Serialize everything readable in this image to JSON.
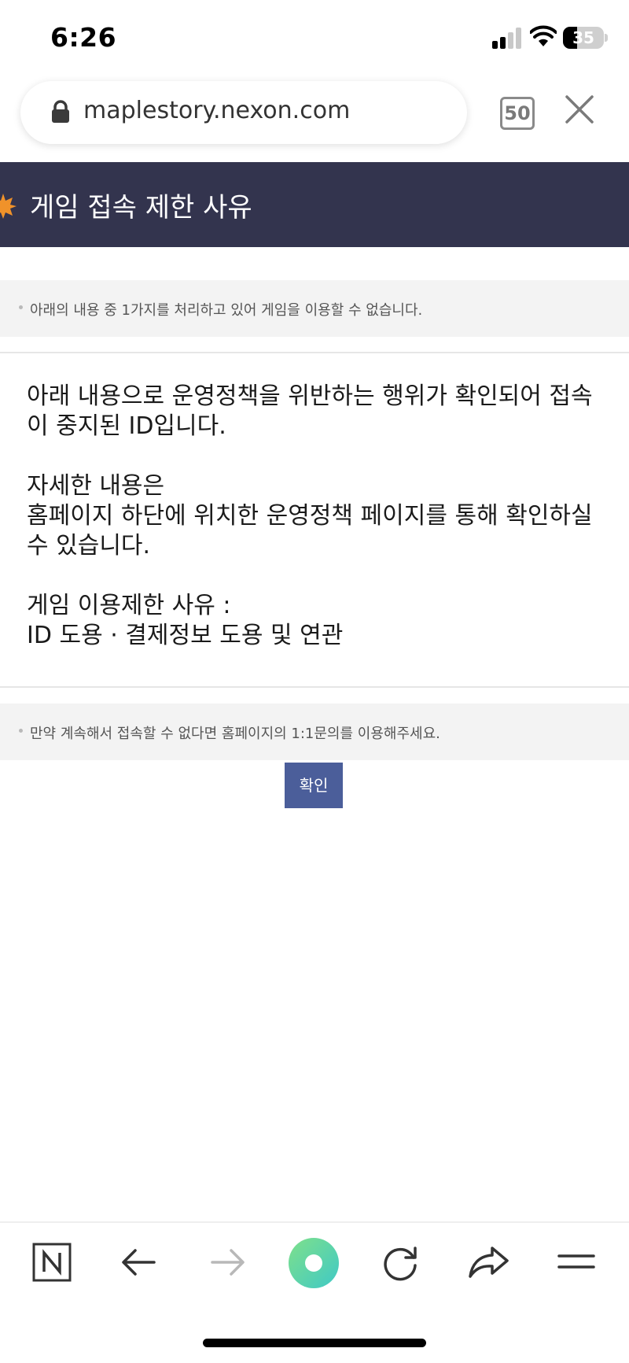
{
  "status_bar": {
    "time": "6:26",
    "battery": "35"
  },
  "browser": {
    "url": "maplestory.nexon.com",
    "tab_count": "50"
  },
  "page": {
    "title": "게임 접속 제한 사유",
    "notice_top": "아래의 내용 중 1가지를 처리하고 있어 게임을 이용할 수 없습니다.",
    "body_text": "아래 내용으로 운영정책을 위반하는 행위가 확인되어 접속이 중지된 ID입니다.\n\n자세한 내용은\n홈페이지 하단에 위치한 운영정책 페이지를 통해 확인하실 수 있습니다.\n\n게임 이용제한 사유 :\nID 도용 · 결제정보 도용 및 연관",
    "notice_bottom": "만약 계속해서 접속할 수 없다면 홈페이지의 1:1문의를 이용해주세요.",
    "confirm_label": "확인"
  },
  "toolbar": {
    "icons": [
      "naver-home-icon",
      "back-arrow-icon",
      "forward-arrow-icon",
      "green-dot-icon",
      "reload-icon",
      "share-icon",
      "menu-icon"
    ]
  },
  "colors": {
    "header_bg": "#33344e",
    "button_bg": "#4b5e9a",
    "notice_bg": "#f3f3f3"
  }
}
